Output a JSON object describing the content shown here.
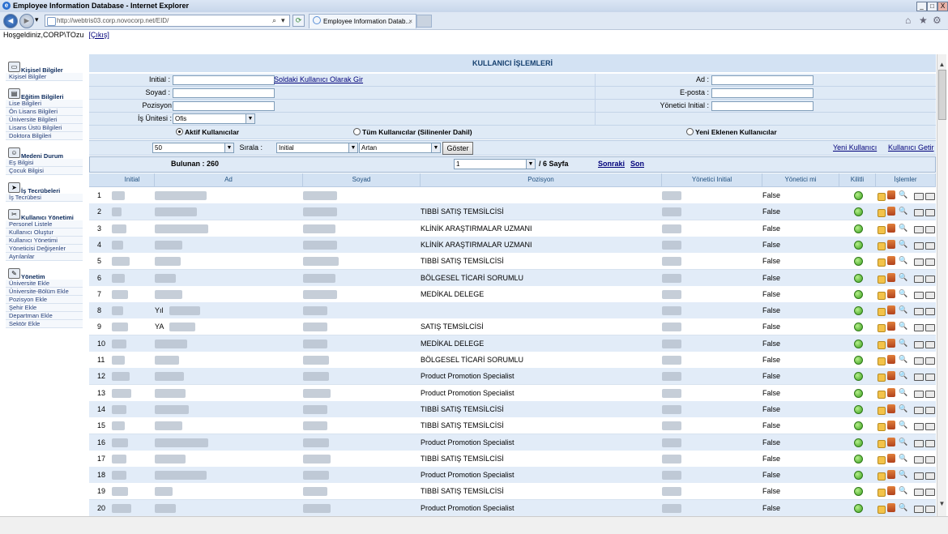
{
  "window": {
    "title": "Employee Information Database - Internet Explorer",
    "min": "_",
    "max": "□",
    "close": "X"
  },
  "browser": {
    "back": "◄",
    "forward": "►",
    "dropdown": "▾",
    "address": "http://webtris03.corp.novocorp.net/EID/",
    "search_glyph": "⌕",
    "refresh": "⟳",
    "tab_label": "Employee Information Datab...",
    "tab_close": "×",
    "home": "⌂",
    "favorites": "★",
    "tools": "⚙"
  },
  "user": {
    "greeting": "Hoşgeldiniz,CORP\\TOzu",
    "logout": "[Çıkış]"
  },
  "sidebar": {
    "sections": [
      {
        "title": "Kişisel Bilgiler",
        "icon": "id-card-icon",
        "items": [
          "Kişisel Bilgiler"
        ]
      },
      {
        "title": "Eğitim Bilgileri",
        "icon": "book-icon",
        "items": [
          "Lise Bilgileri",
          "Ön Lisans Bilgileri",
          "Üniversite Bilgileri",
          "Lisans Üstü Bilgileri",
          "Doktora Bilgileri"
        ]
      },
      {
        "title": "Medeni Durum",
        "icon": "people-icon",
        "items": [
          "Eş Bilgisi",
          "Çocuk Bilgisi"
        ]
      },
      {
        "title": "İş Tecrübeleri",
        "icon": "arrow-circle-icon",
        "items": [
          "İş Tecrübesi"
        ]
      },
      {
        "title": "Kullanıcı Yönetimi",
        "icon": "tools-icon",
        "items": [
          "Personel Listele",
          "Kullanıcı Oluştur",
          "Kullanıcı Yönetimi",
          "Yöneticisi Değişenler",
          "Ayrılanlar"
        ]
      },
      {
        "title": "Yönetim",
        "icon": "wrench-icon",
        "items": [
          "Üniversite Ekle",
          "Üniversite-Bölüm Ekle",
          "Pozisyon Ekle",
          "Şehir Ekle",
          "Departman Ekle",
          "Sektör Ekle"
        ]
      }
    ]
  },
  "form": {
    "header": "KULLANICI İŞLEMLERİ",
    "initial_label": "Initial :",
    "initial_value": "",
    "as_left_user_link": "Soldaki Kullanıcı Olarak Gir",
    "ad_label": "Ad :",
    "ad_value": "",
    "soyad_label": "Soyad :",
    "soyad_value": "",
    "eposta_label": "E-posta :",
    "eposta_value": "",
    "pozisyon_label": "Pozisyon",
    "pozisyon_value": "",
    "yonetici_label": "Yönetici Initial :",
    "yonetici_value": "",
    "isunitesi_label": "İş Ünitesi :",
    "isunitesi_value": "Ofis",
    "radio_active": "Aktif Kullanıcılar",
    "radio_all": "Tüm Kullanıcılar (Silinenler Dahil)",
    "radio_new": "Yeni Eklenen Kullanıcılar",
    "page_size": "50",
    "sort_label": "Sırala :",
    "sort_field": "Initial",
    "sort_dir": "Artan",
    "show_button": "Göster",
    "new_user_link": "Yeni Kullanıcı",
    "get_user_link": "Kullanıcı Getir",
    "found_label": "Bulunan : 260",
    "page_select": "1",
    "page_total": "/ 6 Sayfa",
    "next_link": "Sonraki",
    "last_link": "Son"
  },
  "table": {
    "headers": [
      "Initial",
      "Ad",
      "Soyad",
      "Pozisyon",
      "Yönetici Initial",
      "Yönetici mi",
      "Kilitli",
      "İşlemler"
    ],
    "rows": [
      {
        "no": "1",
        "ad": "",
        "pozisyon": "",
        "yonetici_mi": "False"
      },
      {
        "no": "2",
        "ad": "",
        "pozisyon": "TIBBİ SATIŞ TEMSİLCİSİ",
        "yonetici_mi": "False"
      },
      {
        "no": "3",
        "ad": "",
        "pozisyon": "KLİNİK ARAŞTIRMALAR UZMANI",
        "yonetici_mi": "False"
      },
      {
        "no": "4",
        "ad": "",
        "pozisyon": "KLİNİK ARAŞTIRMALAR UZMANI",
        "yonetici_mi": "False"
      },
      {
        "no": "5",
        "ad": "",
        "pozisyon": "TIBBİ SATIŞ TEMSİLCİSİ",
        "yonetici_mi": "False"
      },
      {
        "no": "6",
        "ad": "",
        "pozisyon": "BÖLGESEL TİCARİ SORUMLU",
        "yonetici_mi": "False"
      },
      {
        "no": "7",
        "ad": "",
        "pozisyon": "MEDİKAL DELEGE",
        "yonetici_mi": "False"
      },
      {
        "no": "8",
        "ad": "Yıl",
        "pozisyon": "",
        "yonetici_mi": "False"
      },
      {
        "no": "9",
        "ad": "YA",
        "pozisyon": "SATIŞ TEMSİLCİSİ",
        "yonetici_mi": "False"
      },
      {
        "no": "10",
        "ad": "",
        "pozisyon": "MEDİKAL DELEGE",
        "yonetici_mi": "False"
      },
      {
        "no": "11",
        "ad": "",
        "pozisyon": "BÖLGESEL TİCARİ SORUMLU",
        "yonetici_mi": "False"
      },
      {
        "no": "12",
        "ad": "",
        "pozisyon": "Product Promotion Specialist",
        "yonetici_mi": "False"
      },
      {
        "no": "13",
        "ad": "",
        "pozisyon": "Product Promotion Specialist",
        "yonetici_mi": "False"
      },
      {
        "no": "14",
        "ad": "",
        "pozisyon": "TIBBİ SATIŞ TEMSİLCİSİ",
        "yonetici_mi": "False"
      },
      {
        "no": "15",
        "ad": "",
        "pozisyon": "TIBBİ SATIŞ TEMSİLCİSİ",
        "yonetici_mi": "False"
      },
      {
        "no": "16",
        "ad": "",
        "pozisyon": "Product Promotion Specialist",
        "yonetici_mi": "False"
      },
      {
        "no": "17",
        "ad": "",
        "pozisyon": "TIBBİ SATIŞ TEMSİLCİSİ",
        "yonetici_mi": "False"
      },
      {
        "no": "18",
        "ad": "",
        "pozisyon": "Product Promotion Specialist",
        "yonetici_mi": "False"
      },
      {
        "no": "19",
        "ad": "",
        "pozisyon": "TIBBİ SATIŞ TEMSİLCİSİ",
        "yonetici_mi": "False"
      },
      {
        "no": "20",
        "ad": "",
        "pozisyon": "Product Promotion Specialist",
        "yonetici_mi": "False"
      }
    ]
  },
  "scroll": {
    "up": "▲",
    "down": "▼"
  }
}
